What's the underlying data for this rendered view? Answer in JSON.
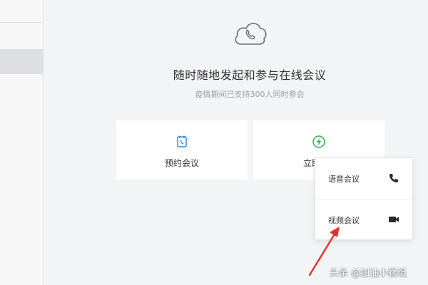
{
  "main": {
    "title": "随时随地发起和参与在线会议",
    "subtitle": "疫情期间已支持300人同时参会",
    "hero_icon": "cloud-phone-icon"
  },
  "cards": [
    {
      "label": "预约会议",
      "icon": "calendar-phone-icon",
      "accent": "#2f8cf0"
    },
    {
      "label": "立即",
      "icon": "lightning-icon",
      "accent": "#2bb24c"
    }
  ],
  "dropdown": {
    "items": [
      {
        "label": "语音会议",
        "icon": "phone-icon"
      },
      {
        "label": "视频会议",
        "icon": "video-camera-icon"
      }
    ]
  },
  "annotation": {
    "color": "#e8302a"
  },
  "watermark": {
    "text": "头条 @加油小猴纸"
  }
}
